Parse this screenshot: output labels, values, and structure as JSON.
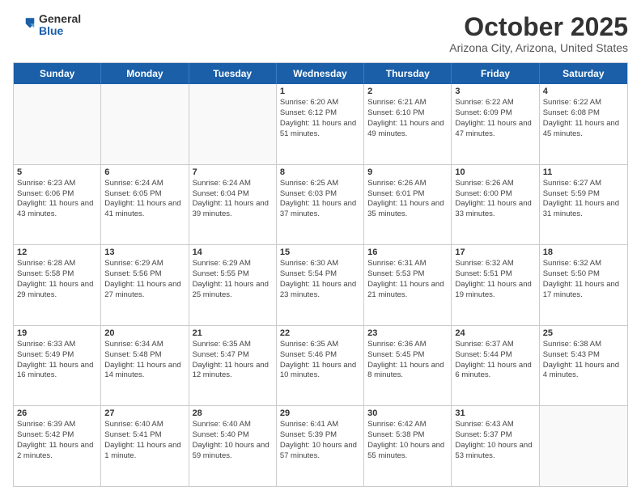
{
  "logo": {
    "general": "General",
    "blue": "Blue"
  },
  "title": {
    "month": "October 2025",
    "location": "Arizona City, Arizona, United States"
  },
  "header": {
    "days": [
      "Sunday",
      "Monday",
      "Tuesday",
      "Wednesday",
      "Thursday",
      "Friday",
      "Saturday"
    ]
  },
  "weeks": [
    [
      {
        "day": "",
        "empty": true
      },
      {
        "day": "",
        "empty": true
      },
      {
        "day": "",
        "empty": true
      },
      {
        "day": "1",
        "sunrise": "6:20 AM",
        "sunset": "6:12 PM",
        "daylight": "11 hours and 51 minutes."
      },
      {
        "day": "2",
        "sunrise": "6:21 AM",
        "sunset": "6:10 PM",
        "daylight": "11 hours and 49 minutes."
      },
      {
        "day": "3",
        "sunrise": "6:22 AM",
        "sunset": "6:09 PM",
        "daylight": "11 hours and 47 minutes."
      },
      {
        "day": "4",
        "sunrise": "6:22 AM",
        "sunset": "6:08 PM",
        "daylight": "11 hours and 45 minutes."
      }
    ],
    [
      {
        "day": "5",
        "sunrise": "6:23 AM",
        "sunset": "6:06 PM",
        "daylight": "11 hours and 43 minutes."
      },
      {
        "day": "6",
        "sunrise": "6:24 AM",
        "sunset": "6:05 PM",
        "daylight": "11 hours and 41 minutes."
      },
      {
        "day": "7",
        "sunrise": "6:24 AM",
        "sunset": "6:04 PM",
        "daylight": "11 hours and 39 minutes."
      },
      {
        "day": "8",
        "sunrise": "6:25 AM",
        "sunset": "6:03 PM",
        "daylight": "11 hours and 37 minutes."
      },
      {
        "day": "9",
        "sunrise": "6:26 AM",
        "sunset": "6:01 PM",
        "daylight": "11 hours and 35 minutes."
      },
      {
        "day": "10",
        "sunrise": "6:26 AM",
        "sunset": "6:00 PM",
        "daylight": "11 hours and 33 minutes."
      },
      {
        "day": "11",
        "sunrise": "6:27 AM",
        "sunset": "5:59 PM",
        "daylight": "11 hours and 31 minutes."
      }
    ],
    [
      {
        "day": "12",
        "sunrise": "6:28 AM",
        "sunset": "5:58 PM",
        "daylight": "11 hours and 29 minutes."
      },
      {
        "day": "13",
        "sunrise": "6:29 AM",
        "sunset": "5:56 PM",
        "daylight": "11 hours and 27 minutes."
      },
      {
        "day": "14",
        "sunrise": "6:29 AM",
        "sunset": "5:55 PM",
        "daylight": "11 hours and 25 minutes."
      },
      {
        "day": "15",
        "sunrise": "6:30 AM",
        "sunset": "5:54 PM",
        "daylight": "11 hours and 23 minutes."
      },
      {
        "day": "16",
        "sunrise": "6:31 AM",
        "sunset": "5:53 PM",
        "daylight": "11 hours and 21 minutes."
      },
      {
        "day": "17",
        "sunrise": "6:32 AM",
        "sunset": "5:51 PM",
        "daylight": "11 hours and 19 minutes."
      },
      {
        "day": "18",
        "sunrise": "6:32 AM",
        "sunset": "5:50 PM",
        "daylight": "11 hours and 17 minutes."
      }
    ],
    [
      {
        "day": "19",
        "sunrise": "6:33 AM",
        "sunset": "5:49 PM",
        "daylight": "11 hours and 16 minutes."
      },
      {
        "day": "20",
        "sunrise": "6:34 AM",
        "sunset": "5:48 PM",
        "daylight": "11 hours and 14 minutes."
      },
      {
        "day": "21",
        "sunrise": "6:35 AM",
        "sunset": "5:47 PM",
        "daylight": "11 hours and 12 minutes."
      },
      {
        "day": "22",
        "sunrise": "6:35 AM",
        "sunset": "5:46 PM",
        "daylight": "11 hours and 10 minutes."
      },
      {
        "day": "23",
        "sunrise": "6:36 AM",
        "sunset": "5:45 PM",
        "daylight": "11 hours and 8 minutes."
      },
      {
        "day": "24",
        "sunrise": "6:37 AM",
        "sunset": "5:44 PM",
        "daylight": "11 hours and 6 minutes."
      },
      {
        "day": "25",
        "sunrise": "6:38 AM",
        "sunset": "5:43 PM",
        "daylight": "11 hours and 4 minutes."
      }
    ],
    [
      {
        "day": "26",
        "sunrise": "6:39 AM",
        "sunset": "5:42 PM",
        "daylight": "11 hours and 2 minutes."
      },
      {
        "day": "27",
        "sunrise": "6:40 AM",
        "sunset": "5:41 PM",
        "daylight": "11 hours and 1 minute."
      },
      {
        "day": "28",
        "sunrise": "6:40 AM",
        "sunset": "5:40 PM",
        "daylight": "10 hours and 59 minutes."
      },
      {
        "day": "29",
        "sunrise": "6:41 AM",
        "sunset": "5:39 PM",
        "daylight": "10 hours and 57 minutes."
      },
      {
        "day": "30",
        "sunrise": "6:42 AM",
        "sunset": "5:38 PM",
        "daylight": "10 hours and 55 minutes."
      },
      {
        "day": "31",
        "sunrise": "6:43 AM",
        "sunset": "5:37 PM",
        "daylight": "10 hours and 53 minutes."
      },
      {
        "day": "",
        "empty": true
      }
    ]
  ]
}
